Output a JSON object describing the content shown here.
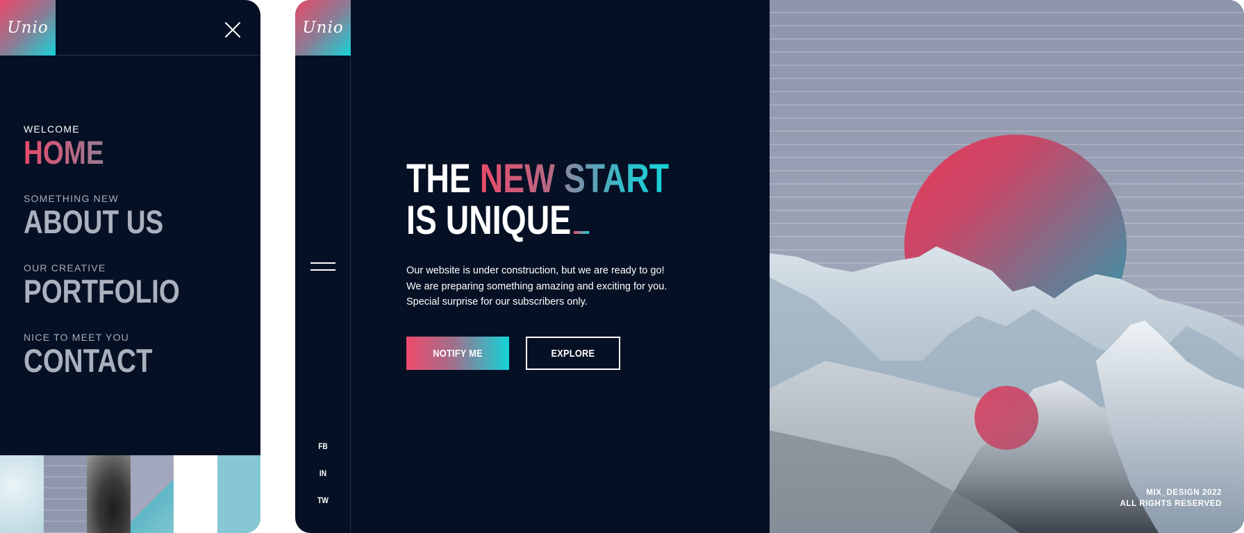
{
  "brand": {
    "logo_text": "Unio"
  },
  "menu": {
    "items": [
      {
        "subtitle": "WELCOME",
        "title": "HOME",
        "active": true
      },
      {
        "subtitle": "SOMETHING NEW",
        "title": "ABOUT US"
      },
      {
        "subtitle": "OUR CREATIVE",
        "title": "PORTFOLIO"
      },
      {
        "subtitle": "NICE TO MEET YOU",
        "title": "CONTACT"
      }
    ]
  },
  "hero": {
    "headline_line1_word1": "THE",
    "headline_line1_word2": "NEW",
    "headline_line1_word3": "START",
    "headline_line2": "IS UNIQUE",
    "body_lines": [
      "Our website is under construction, but we are ready to go!",
      "We are preparing something amazing and exciting for you.",
      "Special surprise for our subscribers only."
    ],
    "notify_label": "NOTIFY ME",
    "explore_label": "EXPLORE"
  },
  "socials": [
    "FB",
    "IN",
    "TW"
  ],
  "footer": {
    "line1": "MIX_DESIGN 2022",
    "line2": "ALL RIGHTS RESERVED"
  },
  "colors": {
    "background": "#061024",
    "accent_pink": "#e84a6a",
    "accent_cyan": "#16d3d7"
  },
  "icons": [
    "close-icon",
    "hamburger-icon"
  ]
}
